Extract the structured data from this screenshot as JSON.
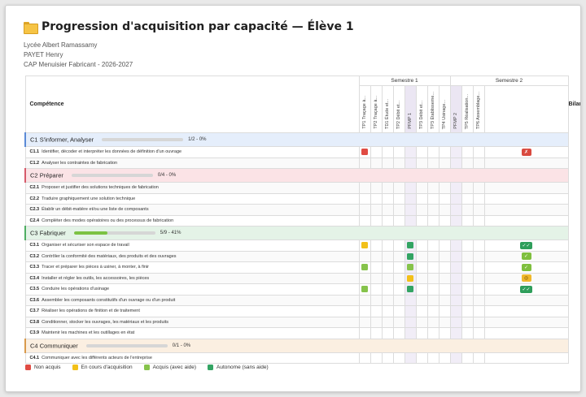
{
  "title": "Progression d'acquisition par capacité — Élève 1",
  "meta": {
    "school": "Lycée Albert Ramassamy",
    "teacher": "PAYET Henry",
    "course": "CAP Menuisier Fabricant - 2026-2027"
  },
  "table": {
    "competence_header": "Compétence",
    "bilan_header": "Bilan",
    "semesters": [
      {
        "label": "Semestre 1",
        "span": 8
      },
      {
        "label": "Semestre 2",
        "span": 4
      }
    ],
    "columns": [
      {
        "label": "TP1 Traçage à...",
        "pfmp": false
      },
      {
        "label": "TP2 Traçage à...",
        "pfmp": false
      },
      {
        "label": "TD1 Étude et...",
        "pfmp": false
      },
      {
        "label": "TP2 Débit et...",
        "pfmp": false
      },
      {
        "label": "PFMP 1",
        "pfmp": true
      },
      {
        "label": "TP3 Débit et...",
        "pfmp": false
      },
      {
        "label": "TP3 Établisseme...",
        "pfmp": false
      },
      {
        "label": "TP4 Usinage...",
        "pfmp": false
      },
      {
        "label": "PFMP 2",
        "pfmp": true
      },
      {
        "label": "TP5 Réalisation...",
        "pfmp": false
      },
      {
        "label": "TP6 Assemblage...",
        "pfmp": false
      }
    ],
    "capacities": [
      {
        "code": "C1",
        "name": "S'informer, Analyser",
        "progress": "1/2 - 0%",
        "fill": 0,
        "theme": "c1",
        "rows": [
          {
            "code": "C1.1",
            "text": "Identifier, décoder et interpréter les données de définition d'un ouvrage",
            "marks": {
              "0": "red"
            },
            "bilan": {
              "type": "red",
              "symbol": "✗"
            }
          },
          {
            "code": "C1.2",
            "text": "Analyser les contraintes de fabrication",
            "marks": {},
            "bilan": null
          }
        ]
      },
      {
        "code": "C2",
        "name": "Préparer",
        "progress": "0/4 - 0%",
        "fill": 0,
        "theme": "c2",
        "rows": [
          {
            "code": "C2.1",
            "text": "Proposer et justifier des solutions techniques de fabrication",
            "marks": {},
            "bilan": null
          },
          {
            "code": "C2.2",
            "text": "Traduire graphiquement une solution technique",
            "marks": {},
            "bilan": null
          },
          {
            "code": "C2.3",
            "text": "Établir un débit-matière et/ou une liste de composants",
            "marks": {},
            "bilan": null
          },
          {
            "code": "C2.4",
            "text": "Compléter des modes opératoires ou des processus de fabrication",
            "marks": {},
            "bilan": null
          }
        ]
      },
      {
        "code": "C3",
        "name": "Fabriquer",
        "progress": "5/9 - 41%",
        "fill": 0.41,
        "theme": "c3",
        "rows": [
          {
            "code": "C3.1",
            "text": "Organiser et sécuriser son espace de travail",
            "marks": {
              "0": "yel",
              "4": "dg"
            },
            "bilan": {
              "type": "dg",
              "symbol": "✓✓",
              "wide": true
            }
          },
          {
            "code": "C3.2",
            "text": "Contrôler la conformité des matériaux, des produits et des ouvrages",
            "marks": {
              "4": "dg"
            },
            "bilan": {
              "type": "lg",
              "symbol": "✓"
            }
          },
          {
            "code": "C3.3",
            "text": "Tracer et préparer les pièces à usiner, à monter, à finir",
            "marks": {
              "0": "lg",
              "4": "lg"
            },
            "bilan": {
              "type": "lg",
              "symbol": "✓"
            }
          },
          {
            "code": "C3.4",
            "text": "Installer et régler les outils, les accessoires, les pièces",
            "marks": {
              "4": "yel"
            },
            "bilan": {
              "type": "yel",
              "symbol": "◎"
            }
          },
          {
            "code": "C3.5",
            "text": "Conduire les opérations d'usinage",
            "marks": {
              "0": "lg",
              "4": "dg"
            },
            "bilan": {
              "type": "dg",
              "symbol": "✓✓",
              "wide": true
            }
          },
          {
            "code": "C3.6",
            "text": "Assembler les composants constitutifs d'un ouvrage ou d'un produit",
            "marks": {},
            "bilan": null
          },
          {
            "code": "C3.7",
            "text": "Réaliser les opérations de finition et de traitement",
            "marks": {},
            "bilan": null
          },
          {
            "code": "C3.8",
            "text": "Conditionner, stocker les ouvrages, les matériaux et les produits",
            "marks": {},
            "bilan": null
          },
          {
            "code": "C3.9",
            "text": "Maintenir les machines et les outillages en état",
            "marks": {},
            "bilan": null
          }
        ]
      },
      {
        "code": "C4",
        "name": "Communiquer",
        "progress": "0/1 - 0%",
        "fill": 0,
        "theme": "c4",
        "rows": [
          {
            "code": "C4.1",
            "text": "Communiquer avec les différents acteurs de l'entreprise",
            "marks": {},
            "bilan": null
          }
        ]
      }
    ]
  },
  "legend": [
    {
      "label": "Non acquis",
      "color": "#e04b43"
    },
    {
      "label": "En cours d'acquisition",
      "color": "#f2c019"
    },
    {
      "label": "Acquis (avec aide)",
      "color": "#86c34b"
    },
    {
      "label": "Autonome (sans aide)",
      "color": "#33a463"
    }
  ]
}
